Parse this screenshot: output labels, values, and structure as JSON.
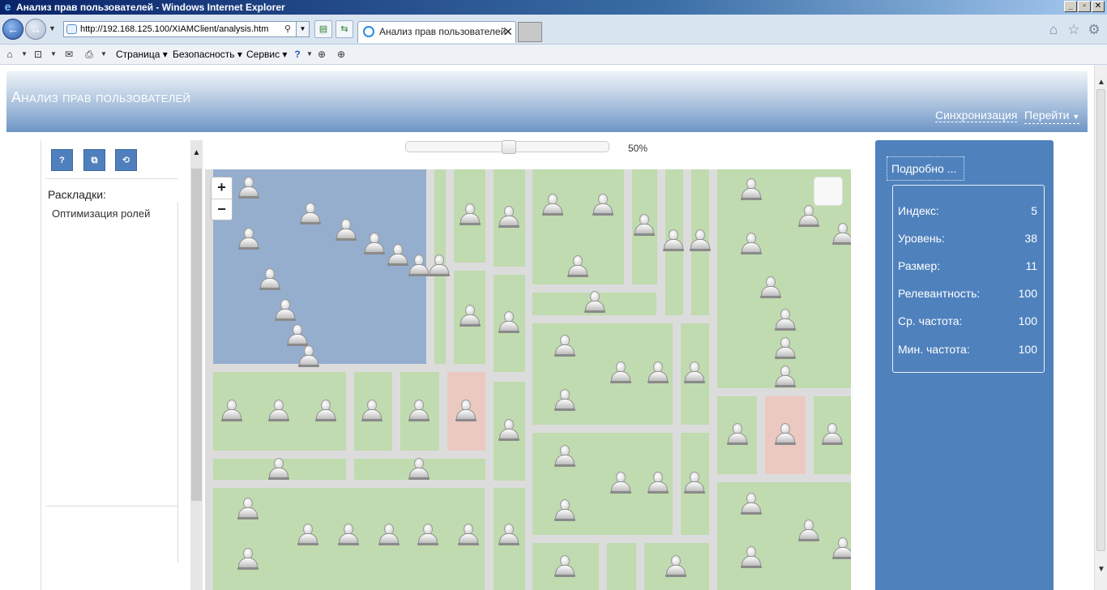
{
  "window": {
    "title": "Анализ прав пользователей - Windows Internet Explorer"
  },
  "browser": {
    "url": "http://192.168.125.100/XIAMClient/analysis.htm",
    "tab_title": "Анализ прав пользователей",
    "tab_close": "✕",
    "commands": [
      "Страница",
      "Безопасность",
      "Сервис"
    ]
  },
  "app": {
    "title": "Анализ прав пользователей",
    "header_links": {
      "sync": "Синхронизация",
      "goto": "Перейти"
    }
  },
  "left_panel": {
    "buttons": [
      "?",
      "⧉",
      "⟲"
    ],
    "layouts_label": "Раскладки:",
    "layouts": [
      "Оптимизация ролей"
    ]
  },
  "slider": {
    "value": 50,
    "label": "50%"
  },
  "map_controls": {
    "zoom_in": "+",
    "zoom_out": "−"
  },
  "treemap": {
    "users_per_cell": [
      13,
      1,
      1,
      1,
      1,
      1,
      2,
      1,
      1,
      1,
      1,
      8,
      1,
      1,
      1,
      1,
      1,
      1,
      1,
      1,
      1,
      1,
      1,
      3,
      1,
      1,
      1,
      2,
      1,
      6,
      1,
      1,
      2,
      1,
      3,
      1,
      1,
      3,
      1,
      1,
      3
    ],
    "cell_colors": {
      "selected": "#95aece",
      "normal": "#c0dbaf",
      "highlight": "#ebc9c1"
    }
  },
  "details": {
    "button": "Подробно ...",
    "rows": [
      {
        "label": "Индекс:",
        "value": "5"
      },
      {
        "label": "Уровень:",
        "value": "38"
      },
      {
        "label": "Размер:",
        "value": "11"
      },
      {
        "label": "Релевантность:",
        "value": "100"
      },
      {
        "label": "Ср. частота:",
        "value": "100"
      },
      {
        "label": "Мин. частота:",
        "value": "100"
      }
    ]
  },
  "icons": {
    "home": "home-icon",
    "favorites": "star-icon",
    "tools": "gear-icon"
  }
}
